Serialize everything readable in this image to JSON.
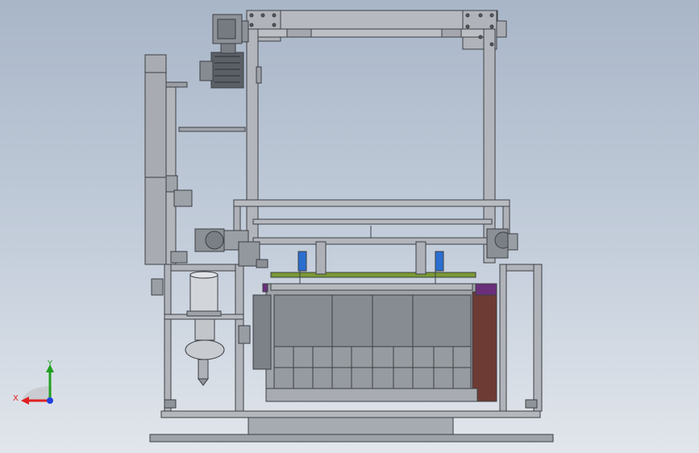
{
  "viewport": {
    "background_top": "#a9b6c8",
    "background_bottom": "#e2e6ec",
    "frame_fill": "#aeb2b8",
    "frame_stroke": "#3c3f44",
    "accent_colors": {
      "tank_side": "#6e3a34",
      "pump_blue": "#2a6fd0",
      "cap_purple": "#6a2f7a",
      "rail_green": "#7a9a34"
    }
  },
  "axis_triad": {
    "x_label": "X",
    "y_label": "Y",
    "x_color": "#e02020",
    "y_color": "#20a020",
    "z_color": "#2040e0"
  }
}
